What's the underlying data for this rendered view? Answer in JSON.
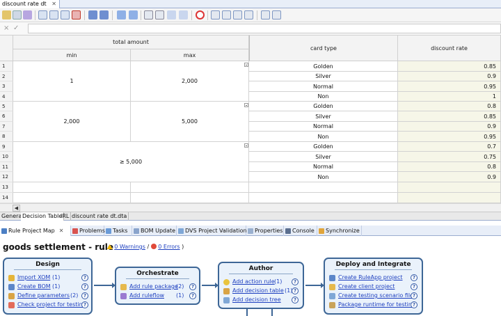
{
  "editor": {
    "tab_title": "discount rate dt",
    "close_glyph": "✕"
  },
  "formula": {
    "cancel_glyph": "×",
    "accept_glyph": "✓",
    "value": ""
  },
  "table": {
    "group_header": "total amount",
    "headers": {
      "min": "min",
      "max": "max",
      "card_type": "card type",
      "discount_rate": "discount rate"
    },
    "row_numbers": [
      "1",
      "2",
      "3",
      "4",
      "5",
      "6",
      "7",
      "8",
      "9",
      "10",
      "11",
      "12",
      "13",
      "14"
    ],
    "condition_groups": [
      {
        "min": "1",
        "max": "2,000"
      },
      {
        "min": "2,000",
        "max": "5,000"
      },
      {
        "range": "≥ 5,000"
      }
    ],
    "rows": [
      {
        "card_type": "Golden",
        "rate": "0.85"
      },
      {
        "card_type": "Silver",
        "rate": "0.9"
      },
      {
        "card_type": "Normal",
        "rate": "0.95"
      },
      {
        "card_type": "Non",
        "rate": "1"
      },
      {
        "card_type": "Golden",
        "rate": "0.8"
      },
      {
        "card_type": "Silver",
        "rate": "0.85"
      },
      {
        "card_type": "Normal",
        "rate": "0.9"
      },
      {
        "card_type": "Non",
        "rate": "0.95"
      },
      {
        "card_type": "Golden",
        "rate": "0.7"
      },
      {
        "card_type": "Silver",
        "rate": "0.75"
      },
      {
        "card_type": "Normal",
        "rate": "0.8"
      },
      {
        "card_type": "Non",
        "rate": "0.9"
      }
    ],
    "accent_rate_bg": "#f6f6e8"
  },
  "scroll": {
    "left_arrow": "◀"
  },
  "sheet_tabs": [
    "General",
    "Decision Table",
    "IRL",
    "discount rate dt.dta"
  ],
  "views": {
    "tabs": [
      "Rule Project Map",
      "Problems",
      "Tasks",
      "BOM Update",
      "DVS Project Validation",
      "Properties",
      "Console",
      "Synchronize"
    ],
    "close_glyph": "✕"
  },
  "project_map": {
    "title": "goods settlement - rule",
    "warnings_link": "0 Warnings",
    "errors_link": "0 Errors",
    "paren_open": "(",
    "slash": "/",
    "paren_close": ")",
    "help_glyph": "?",
    "design": {
      "title": "Design",
      "items": [
        {
          "label": "Import XOM",
          "count": "(1)"
        },
        {
          "label": "Create BOM",
          "count": "(1)"
        },
        {
          "label": "Define parameters",
          "count": "(2)"
        },
        {
          "label": "Check project for testing",
          "count": ""
        }
      ]
    },
    "orchestrate": {
      "title": "Orchestrate",
      "items": [
        {
          "label": "Add rule package",
          "count": "(2)"
        },
        {
          "label": "Add ruleflow",
          "count": "(1)"
        }
      ]
    },
    "author": {
      "title": "Author",
      "items": [
        {
          "label": "Add action rule",
          "count": "(1)"
        },
        {
          "label": "Add decision table",
          "count": "(1)"
        },
        {
          "label": "Add decision tree",
          "count": ""
        }
      ]
    },
    "deploy": {
      "title": "Deploy and Integrate",
      "items": [
        {
          "label": "Create RuleApp project",
          "count": ""
        },
        {
          "label": "Create client project",
          "count": ""
        },
        {
          "label": "Create testing scenario file",
          "count": ""
        },
        {
          "label": "Package runtime for testing",
          "count": ""
        }
      ]
    }
  },
  "icons": {
    "toolbar": [
      "edit-icon",
      "table-icon",
      "format-icon",
      "insert-row-icon",
      "insert-column-icon",
      "delete-row-icon",
      "delete-column-icon",
      "collapse-icon",
      "expand-icon",
      "move-up-icon",
      "move-down-icon",
      "split-icon",
      "merge-icon",
      "sort-icon",
      "sort-desc-icon",
      "error-icon",
      "column-left-icon",
      "column-right-icon",
      "column-icon",
      "column-alt-icon",
      "table-props-icon",
      "zoom-icon"
    ]
  }
}
